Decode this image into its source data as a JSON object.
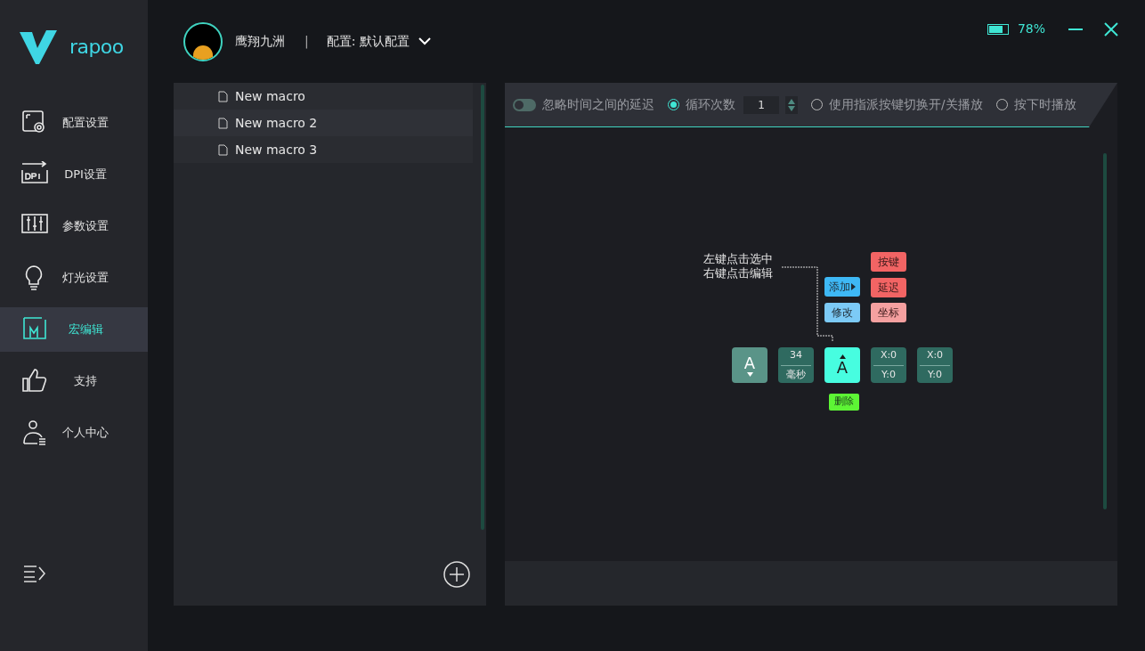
{
  "logo": {
    "wordmark": "rapoo"
  },
  "battery": {
    "level": 0.78,
    "reading": "78%"
  },
  "nav": [
    {
      "kind": "config",
      "label": "配置设置",
      "selected": false
    },
    {
      "kind": "dpi",
      "label": "DPI设置",
      "selected": false
    },
    {
      "kind": "params",
      "label": "参数设置",
      "selected": false
    },
    {
      "kind": "light",
      "label": "灯光设置",
      "selected": false
    },
    {
      "kind": "macro",
      "label": "宏编辑",
      "selected": true
    },
    {
      "kind": "support",
      "label": "支持",
      "selected": false
    },
    {
      "kind": "user",
      "label": "个人中心",
      "selected": false
    }
  ],
  "header": {
    "username": "鹰翔九洲",
    "separator": "|",
    "profile": "配置: 默认配置"
  },
  "macros": [
    {
      "name": "New macro"
    },
    {
      "name": "New macro 2"
    },
    {
      "name": "New macro 3"
    }
  ],
  "options": [
    {
      "kind": "toggle",
      "label": "忽略时间之间的延迟",
      "on": false
    },
    {
      "kind": "radio",
      "label": "循环次数",
      "selected": true,
      "count": "1"
    },
    {
      "kind": "radio",
      "label": "使用指派按键切换开/关播放",
      "selected": false
    },
    {
      "kind": "radio",
      "label": "按下时播放",
      "selected": false
    }
  ],
  "hint": [
    "左键点击选中",
    "右键点击编辑"
  ],
  "actions": [
    {
      "label": "添加",
      "submenu": true,
      "color": "#3eb8f5"
    },
    {
      "label": "修改",
      "submenu": false,
      "color": "#7ccaf6"
    }
  ],
  "add_types": [
    {
      "label": "按键",
      "color": "#f26464"
    },
    {
      "label": "延迟",
      "color": "#f26464"
    },
    {
      "label": "坐标",
      "color": "#f5a0a0"
    }
  ],
  "events": [
    {
      "kind": "key",
      "label": "A",
      "release": false,
      "selected": false
    },
    {
      "kind": "delay",
      "value": "34",
      "unit": "毫秒"
    },
    {
      "kind": "key",
      "label": "A",
      "release": true,
      "selected": true
    },
    {
      "kind": "coord",
      "x": "X:0",
      "y": "Y:0"
    },
    {
      "kind": "coord",
      "x": "X:0",
      "y": "Y:0"
    }
  ],
  "delete_button": "删除"
}
